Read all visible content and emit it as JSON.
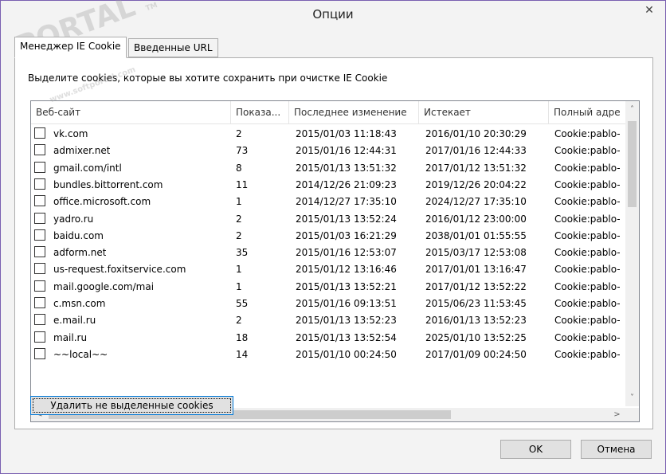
{
  "window": {
    "title": "Опции",
    "close_glyph": "✕"
  },
  "tabs": [
    {
      "label": "Менеджер IE Cookie"
    },
    {
      "label": "Введенные URL"
    }
  ],
  "hint": "Выделите cookies, которые вы хотите сохранить при очистке IE Cookie",
  "columns": [
    {
      "label": "Веб-сайт"
    },
    {
      "label": "Показа..."
    },
    {
      "label": "Последнее изменение"
    },
    {
      "label": "Истекает"
    },
    {
      "label": "Полный адре"
    }
  ],
  "rows": [
    {
      "site": "vk.com",
      "count": "2",
      "modified": "2015/01/03 11:18:43",
      "expires": "2016/01/10 20:30:29",
      "path": "Cookie:pablo-"
    },
    {
      "site": "admixer.net",
      "count": "73",
      "modified": "2015/01/16 12:44:31",
      "expires": "2017/01/16 12:44:33",
      "path": "Cookie:pablo-"
    },
    {
      "site": "gmail.com/intl",
      "count": "8",
      "modified": "2015/01/13 13:51:32",
      "expires": "2017/01/12 13:51:32",
      "path": "Cookie:pablo-"
    },
    {
      "site": "bundles.bittorrent.com",
      "count": "11",
      "modified": "2014/12/26 21:09:23",
      "expires": "2019/12/26 20:04:22",
      "path": "Cookie:pablo-"
    },
    {
      "site": "office.microsoft.com",
      "count": "1",
      "modified": "2014/12/27 17:35:10",
      "expires": "2024/12/27 17:35:10",
      "path": "Cookie:pablo-"
    },
    {
      "site": "yadro.ru",
      "count": "2",
      "modified": "2015/01/13 13:52:24",
      "expires": "2016/01/12 23:00:00",
      "path": "Cookie:pablo-"
    },
    {
      "site": "baidu.com",
      "count": "2",
      "modified": "2015/01/03 16:21:29",
      "expires": "2038/01/01 01:55:55",
      "path": "Cookie:pablo-"
    },
    {
      "site": "adform.net",
      "count": "35",
      "modified": "2015/01/16 12:53:07",
      "expires": "2015/03/17 12:53:08",
      "path": "Cookie:pablo-"
    },
    {
      "site": "us-request.foxitservice.com",
      "count": "1",
      "modified": "2015/01/12 13:16:46",
      "expires": "2017/01/01 13:16:47",
      "path": "Cookie:pablo-"
    },
    {
      "site": "mail.google.com/mai",
      "count": "1",
      "modified": "2015/01/13 13:52:21",
      "expires": "2017/01/12 13:52:22",
      "path": "Cookie:pablo-"
    },
    {
      "site": "c.msn.com",
      "count": "55",
      "modified": "2015/01/16 09:13:51",
      "expires": "2015/06/23 11:53:45",
      "path": "Cookie:pablo-"
    },
    {
      "site": "e.mail.ru",
      "count": "2",
      "modified": "2015/01/13 13:52:23",
      "expires": "2016/01/13 13:52:23",
      "path": "Cookie:pablo-"
    },
    {
      "site": "mail.ru",
      "count": "18",
      "modified": "2015/01/13 13:52:54",
      "expires": "2025/01/10 13:52:25",
      "path": "Cookie:pablo-"
    },
    {
      "site": "~~local~~",
      "count": "14",
      "modified": "2015/01/10 00:24:50",
      "expires": "2017/01/09 00:24:50",
      "path": "Cookie:pablo-"
    }
  ],
  "buttons": {
    "delete_unselected": "Удалить не выделенные cookies",
    "ok": "OK",
    "cancel": "Отмена"
  },
  "scroll": {
    "up": "˄",
    "down": "˅",
    "left": "<",
    "right": ">"
  },
  "watermark": {
    "text": "PORTAL",
    "sub": "www.softportal.com",
    "mark": "TM"
  }
}
